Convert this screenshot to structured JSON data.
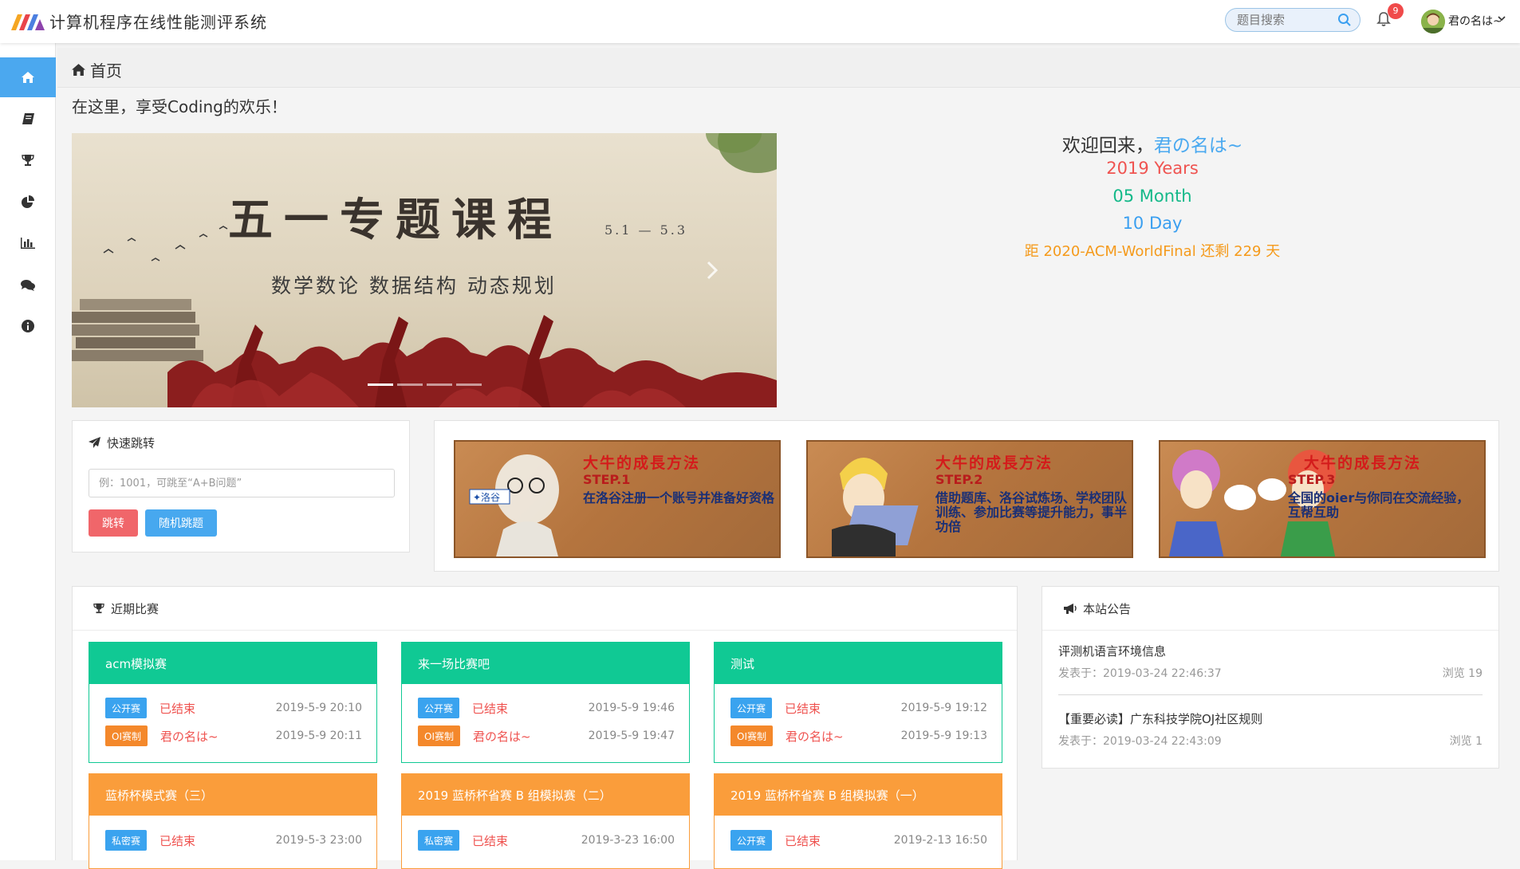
{
  "app": {
    "title": "计算机程序在线性能测评系统"
  },
  "header": {
    "search_placeholder": "题目搜索",
    "notification_count": "9",
    "user_name": "君の名は~"
  },
  "sidebar": {
    "items": [
      {
        "icon": "home-icon",
        "active": true
      },
      {
        "icon": "book-icon"
      },
      {
        "icon": "trophy-icon"
      },
      {
        "icon": "pie-chart-icon"
      },
      {
        "icon": "bar-chart-icon"
      },
      {
        "icon": "comments-icon"
      },
      {
        "icon": "info-icon"
      }
    ]
  },
  "breadcrumb": {
    "label": "首页"
  },
  "welcome_line": "在这里，享受Coding的欢乐！",
  "carousel": {
    "title": "五一专题课程",
    "date": "5.1 — 5.3",
    "subtitle": "数学数论  数据结构  动态规划",
    "slides": 4,
    "active_slide": 1
  },
  "greeting": {
    "prefix": "欢迎回来，",
    "name": "君の名は~",
    "year": "2019 Years",
    "month": "05 Month",
    "day": "10 Day",
    "countdown": "距 2020-ACM-WorldFinal 还剩 229 天",
    "colors": {
      "name": "#4aa9f0",
      "year": "#ef5350",
      "month": "#14b989",
      "day": "#3a9ff0",
      "countdown": "#f59a1b"
    }
  },
  "quick_jump": {
    "title": "快速跳转",
    "placeholder": "例：1001，可跳至“A+B问题”",
    "jump_label": "跳转",
    "random_label": "随机跳题"
  },
  "steps": [
    {
      "title": "大牛的成長方法",
      "step": "STEP.1",
      "text": "在洛谷注册一个账号并准备好资格"
    },
    {
      "title": "大牛的成長方法",
      "step": "STEP.2",
      "text": "借助题库、洛谷试炼场、学校团队训练、参加比赛等提升能力，事半功倍"
    },
    {
      "title": "大牛的成長方法",
      "step": "STEP.3",
      "text": "全国的oier与你同在交流经验，互帮互助"
    }
  ],
  "contests": {
    "title": "近期比赛",
    "items": [
      {
        "name": "acm模拟赛",
        "color": "green",
        "tag1": "公开赛",
        "tag1_color": "blue",
        "status": "已结束",
        "start": "2019-5-9 20:10",
        "tag2": "OI赛制",
        "owner": "君の名は~",
        "end": "2019-5-9 20:11"
      },
      {
        "name": "来一场比赛吧",
        "color": "green",
        "tag1": "公开赛",
        "tag1_color": "blue",
        "status": "已结束",
        "start": "2019-5-9 19:46",
        "tag2": "OI赛制",
        "owner": "君の名は~",
        "end": "2019-5-9 19:47"
      },
      {
        "name": "测试",
        "color": "green",
        "tag1": "公开赛",
        "tag1_color": "blue",
        "status": "已结束",
        "start": "2019-5-9 19:12",
        "tag2": "OI赛制",
        "owner": "君の名は~",
        "end": "2019-5-9 19:13"
      },
      {
        "name": "蓝桥杯模式赛（三）",
        "color": "orange",
        "tag1": "私密赛",
        "tag1_color": "blue",
        "status": "已结束",
        "start": "2019-5-3 23:00"
      },
      {
        "name": "2019 蓝桥杯省赛 B 组模拟赛（二）",
        "color": "orange",
        "tag1": "私密赛",
        "tag1_color": "blue",
        "status": "已结束",
        "start": "2019-3-23 16:00"
      },
      {
        "name": "2019 蓝桥杯省赛 B 组模拟赛（一）",
        "color": "orange",
        "tag1": "公开赛",
        "tag1_color": "blue",
        "status": "已结束",
        "start": "2019-2-13 16:50"
      }
    ]
  },
  "notices": {
    "title": "本站公告",
    "items": [
      {
        "title": "评测机语言环境信息",
        "meta": "发表于：2019-03-24 22:46:37",
        "views": "浏览 19"
      },
      {
        "title": "【重要必读】广东科技学院OJ社区规则",
        "meta": "发表于：2019-03-24 22:43:09",
        "views": "浏览 1"
      }
    ]
  },
  "colors": {
    "accent": "#4ba8ef",
    "green": "#10c994",
    "orange": "#fa9d3b",
    "tag_blue": "#3aa3ef",
    "tag_orange": "#f4882b",
    "danger": "#ef5350"
  }
}
